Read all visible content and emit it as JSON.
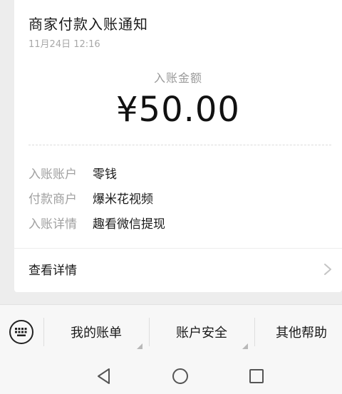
{
  "card": {
    "title": "商家付款入账通知",
    "time": "11月24日  12:16",
    "amount_label": "入账金额",
    "amount": "¥50.00",
    "details": [
      {
        "key": "入账账户",
        "value": "零钱"
      },
      {
        "key": "付款商户",
        "value": "爆米花视频"
      },
      {
        "key": "入账详情",
        "value": "趣看微信提现"
      }
    ],
    "view_detail": "查看详情"
  },
  "menu": {
    "items": [
      "我的账单",
      "账户安全",
      "其他帮助"
    ]
  },
  "icons": {
    "keyboard": "keyboard-icon",
    "chevron": "chevron-right-icon",
    "back": "nav-back-icon",
    "home": "nav-home-icon",
    "recent": "nav-recent-icon"
  }
}
